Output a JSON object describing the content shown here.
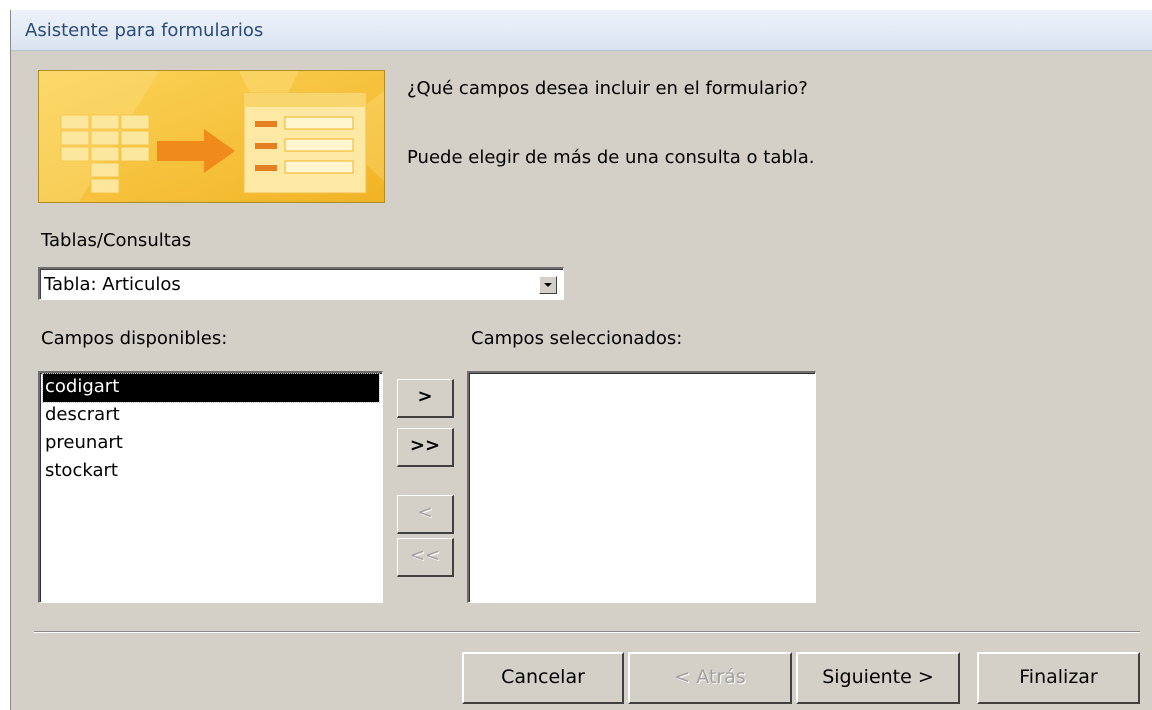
{
  "window": {
    "title": "Asistente para formularios"
  },
  "intro": {
    "question": "¿Qué campos desea incluir en el formulario?",
    "hint": "Puede elegir de más de una consulta o tabla."
  },
  "source": {
    "label": "Tablas/Consultas",
    "selected": "Tabla: Articulos"
  },
  "available": {
    "label": "Campos disponibles:",
    "items": [
      "codigart",
      "descrart",
      "preunart",
      "stockart"
    ],
    "selected_index": 0
  },
  "selected_fields": {
    "label": "Campos seleccionados:",
    "items": []
  },
  "move_buttons": {
    "add_one": ">",
    "add_all": ">>",
    "remove_one": "<",
    "remove_all": "<<"
  },
  "footer": {
    "cancel": "Cancelar",
    "back": "< Atrás",
    "next": "Siguiente >",
    "finish": "Finalizar"
  },
  "colors": {
    "dialog_bg": "#d4d0c8",
    "banner_bg": "#f7c23c",
    "selection": "#000000"
  }
}
